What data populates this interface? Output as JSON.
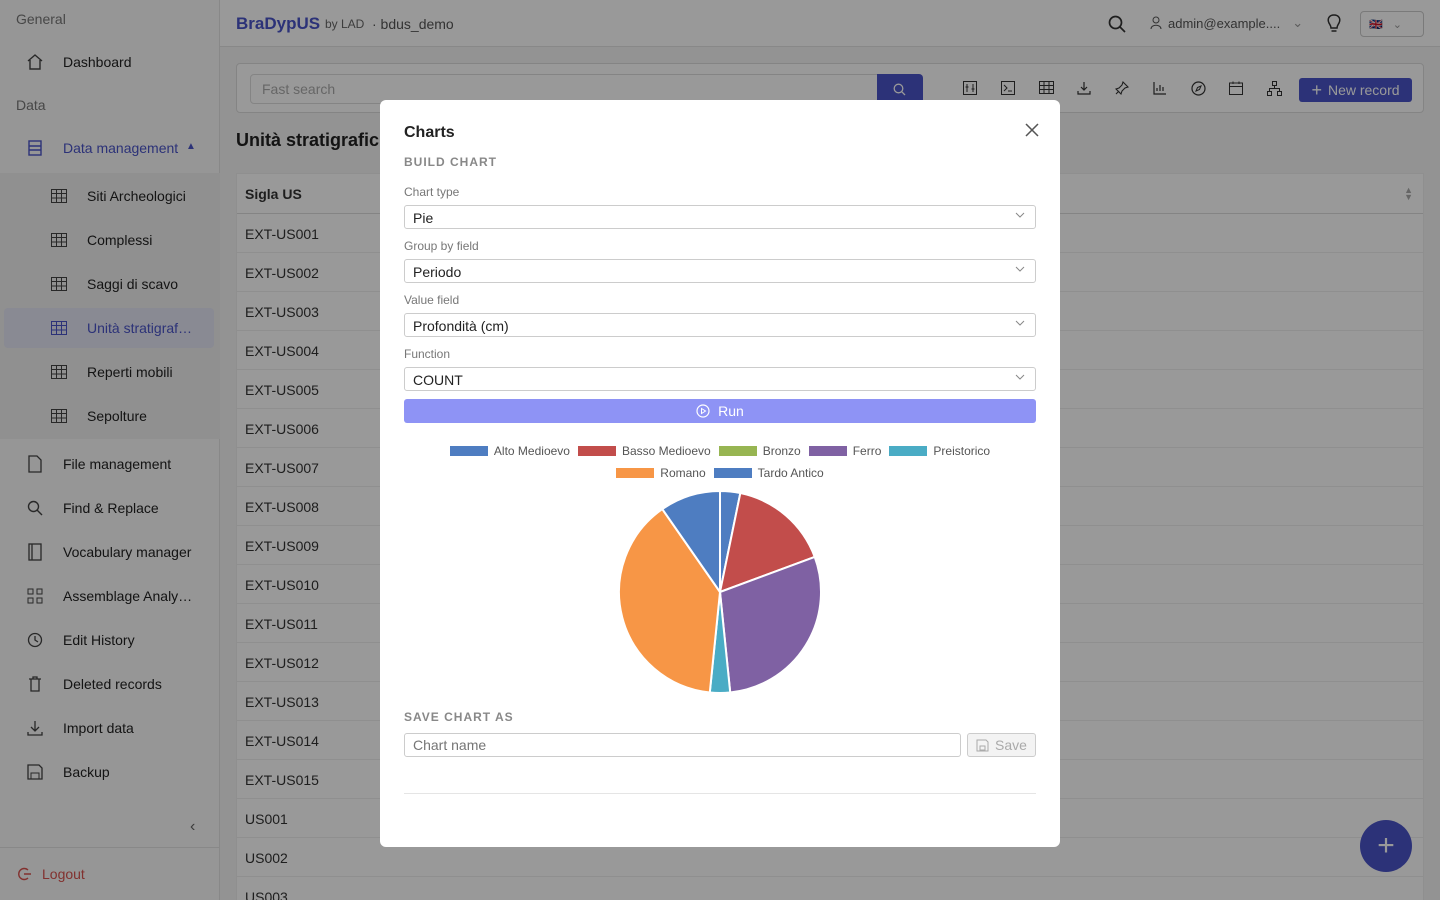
{
  "sidebar": {
    "section_general": "General",
    "section_data": "Data",
    "dashboard": "Dashboard",
    "data_management": "Data management",
    "sub_items": [
      "Siti Archeologici",
      "Complessi",
      "Saggi di scavo",
      "Unità stratigraf…",
      "Reperti mobili",
      "Sepolture"
    ],
    "items": [
      "File management",
      "Find & Replace",
      "Vocabulary manager",
      "Assemblage Analy…",
      "Edit History",
      "Deleted records",
      "Import data",
      "Backup"
    ],
    "logout": "Logout"
  },
  "topbar": {
    "brand": "BraDypUS",
    "by": "by LAD",
    "app": "· bdus_demo",
    "user": "admin@example....",
    "lang_flag": "🇬🇧"
  },
  "toolbar": {
    "search_placeholder": "Fast search",
    "new_record": "New record"
  },
  "page": {
    "title": "Unità stratigrafic",
    "column_header": "Sigla US",
    "rows": [
      "EXT-US001",
      "EXT-US002",
      "EXT-US003",
      "EXT-US004",
      "EXT-US005",
      "EXT-US006",
      "EXT-US007",
      "EXT-US008",
      "EXT-US009",
      "EXT-US010",
      "EXT-US011",
      "EXT-US012",
      "EXT-US013",
      "EXT-US014",
      "EXT-US015",
      "US001",
      "US002",
      "US003"
    ]
  },
  "modal": {
    "title": "Charts",
    "build_heading": "BUILD CHART",
    "chart_type_label": "Chart type",
    "chart_type_value": "Pie",
    "group_by_label": "Group by field",
    "group_by_value": "Periodo",
    "value_field_label": "Value field",
    "value_field_value": "Profondità (cm)",
    "function_label": "Function",
    "function_value": "COUNT",
    "run_label": "Run",
    "save_heading": "SAVE CHART AS",
    "chart_name_placeholder": "Chart name",
    "save_label": "Save"
  },
  "colors": {
    "accent": "#4a54c8",
    "run": "#8e93f5"
  },
  "chart_data": {
    "type": "pie",
    "categories": [
      "Alto Medioevo",
      "Basso Medioevo",
      "Bronzo",
      "Ferro",
      "Preistorico",
      "Romano",
      "Tardo Antico"
    ],
    "values": [
      1,
      5,
      0,
      9,
      1,
      12,
      3
    ],
    "colors": [
      "#4e7dc1",
      "#c24d4b",
      "#97b552",
      "#7f61a3",
      "#4aacc5",
      "#f79646",
      "#4e7dc1"
    ],
    "legend": "top"
  }
}
